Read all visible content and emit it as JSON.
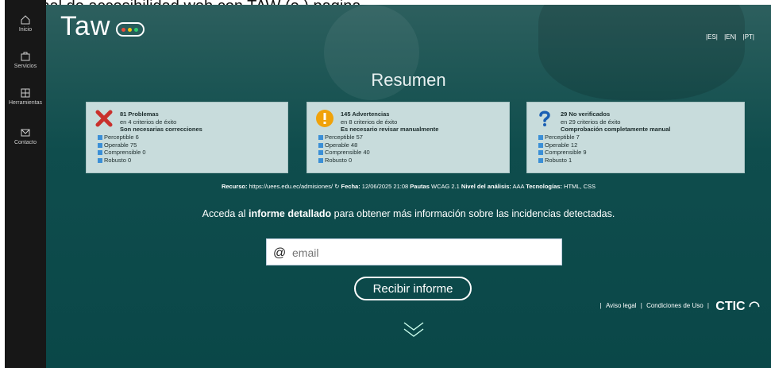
{
  "top_cut_text": "e global de accesibilidad web con TAW (e     ) pagina",
  "sidebar": {
    "items": [
      {
        "label": "Inicio",
        "icon": "home-icon"
      },
      {
        "label": "Servicios",
        "icon": "briefcase-icon"
      },
      {
        "label": "Herramientas",
        "icon": "tools-icon"
      },
      {
        "label": "Contacto",
        "icon": "mail-icon"
      }
    ]
  },
  "header": {
    "logo_text": "Taw",
    "languages": [
      "|ES|",
      "|EN|",
      "|PT|"
    ]
  },
  "summary_title": "Resumen",
  "boxes": [
    {
      "icon": "error-x-icon",
      "title": "81 Problemas",
      "subtitle": "en 4 criterios de éxito",
      "note": "Son necesarias correcciones",
      "items": [
        "Perceptible 6",
        "Operable 75",
        "Comprensible 0",
        "Robusto 0"
      ]
    },
    {
      "icon": "warning-icon",
      "title": "145 Advertencias",
      "subtitle": "en 8 criterios de éxito",
      "note": "Es necesario revisar manualmente",
      "items": [
        "Perceptible 57",
        "Operable 48",
        "Comprensible 40",
        "Robusto 0"
      ]
    },
    {
      "icon": "question-icon",
      "title": "29 No verificados",
      "subtitle": "en 29 criterios de éxito",
      "note": "Comprobación completamente manual",
      "items": [
        "Perceptible 7",
        "Operable 12",
        "Comprensible 9",
        "Robusto 1"
      ]
    }
  ],
  "meta": {
    "recurso_label": "Recurso:",
    "recurso_value": "https://uees.edu.ec/admisiones/",
    "fecha_label": "Fecha:",
    "fecha_value": "12/06/2025 21:08",
    "pautas_label": "Pautas",
    "pautas_value": "WCAG 2.1",
    "nivel_label": "Nivel del análisis:",
    "nivel_value": "AAA",
    "tec_label": "Tecnologías:",
    "tec_value": "HTML, CSS"
  },
  "lead": {
    "pre": "Acceda al ",
    "strong": "informe detallado",
    "post": " para obtener más información sobre las incidencias detectadas."
  },
  "email": {
    "at": "@",
    "placeholder": "email",
    "value": ""
  },
  "button_label": "Recibir informe",
  "footer": {
    "links": [
      "Aviso legal",
      "Condiciones de Uso"
    ],
    "separator": "|",
    "brand": "CTIC"
  },
  "colors": {
    "accent_blue": "#3a8fd6",
    "error_red": "#c9302c",
    "warning_orange": "#f0a20a",
    "question_blue": "#1a5fb4"
  }
}
